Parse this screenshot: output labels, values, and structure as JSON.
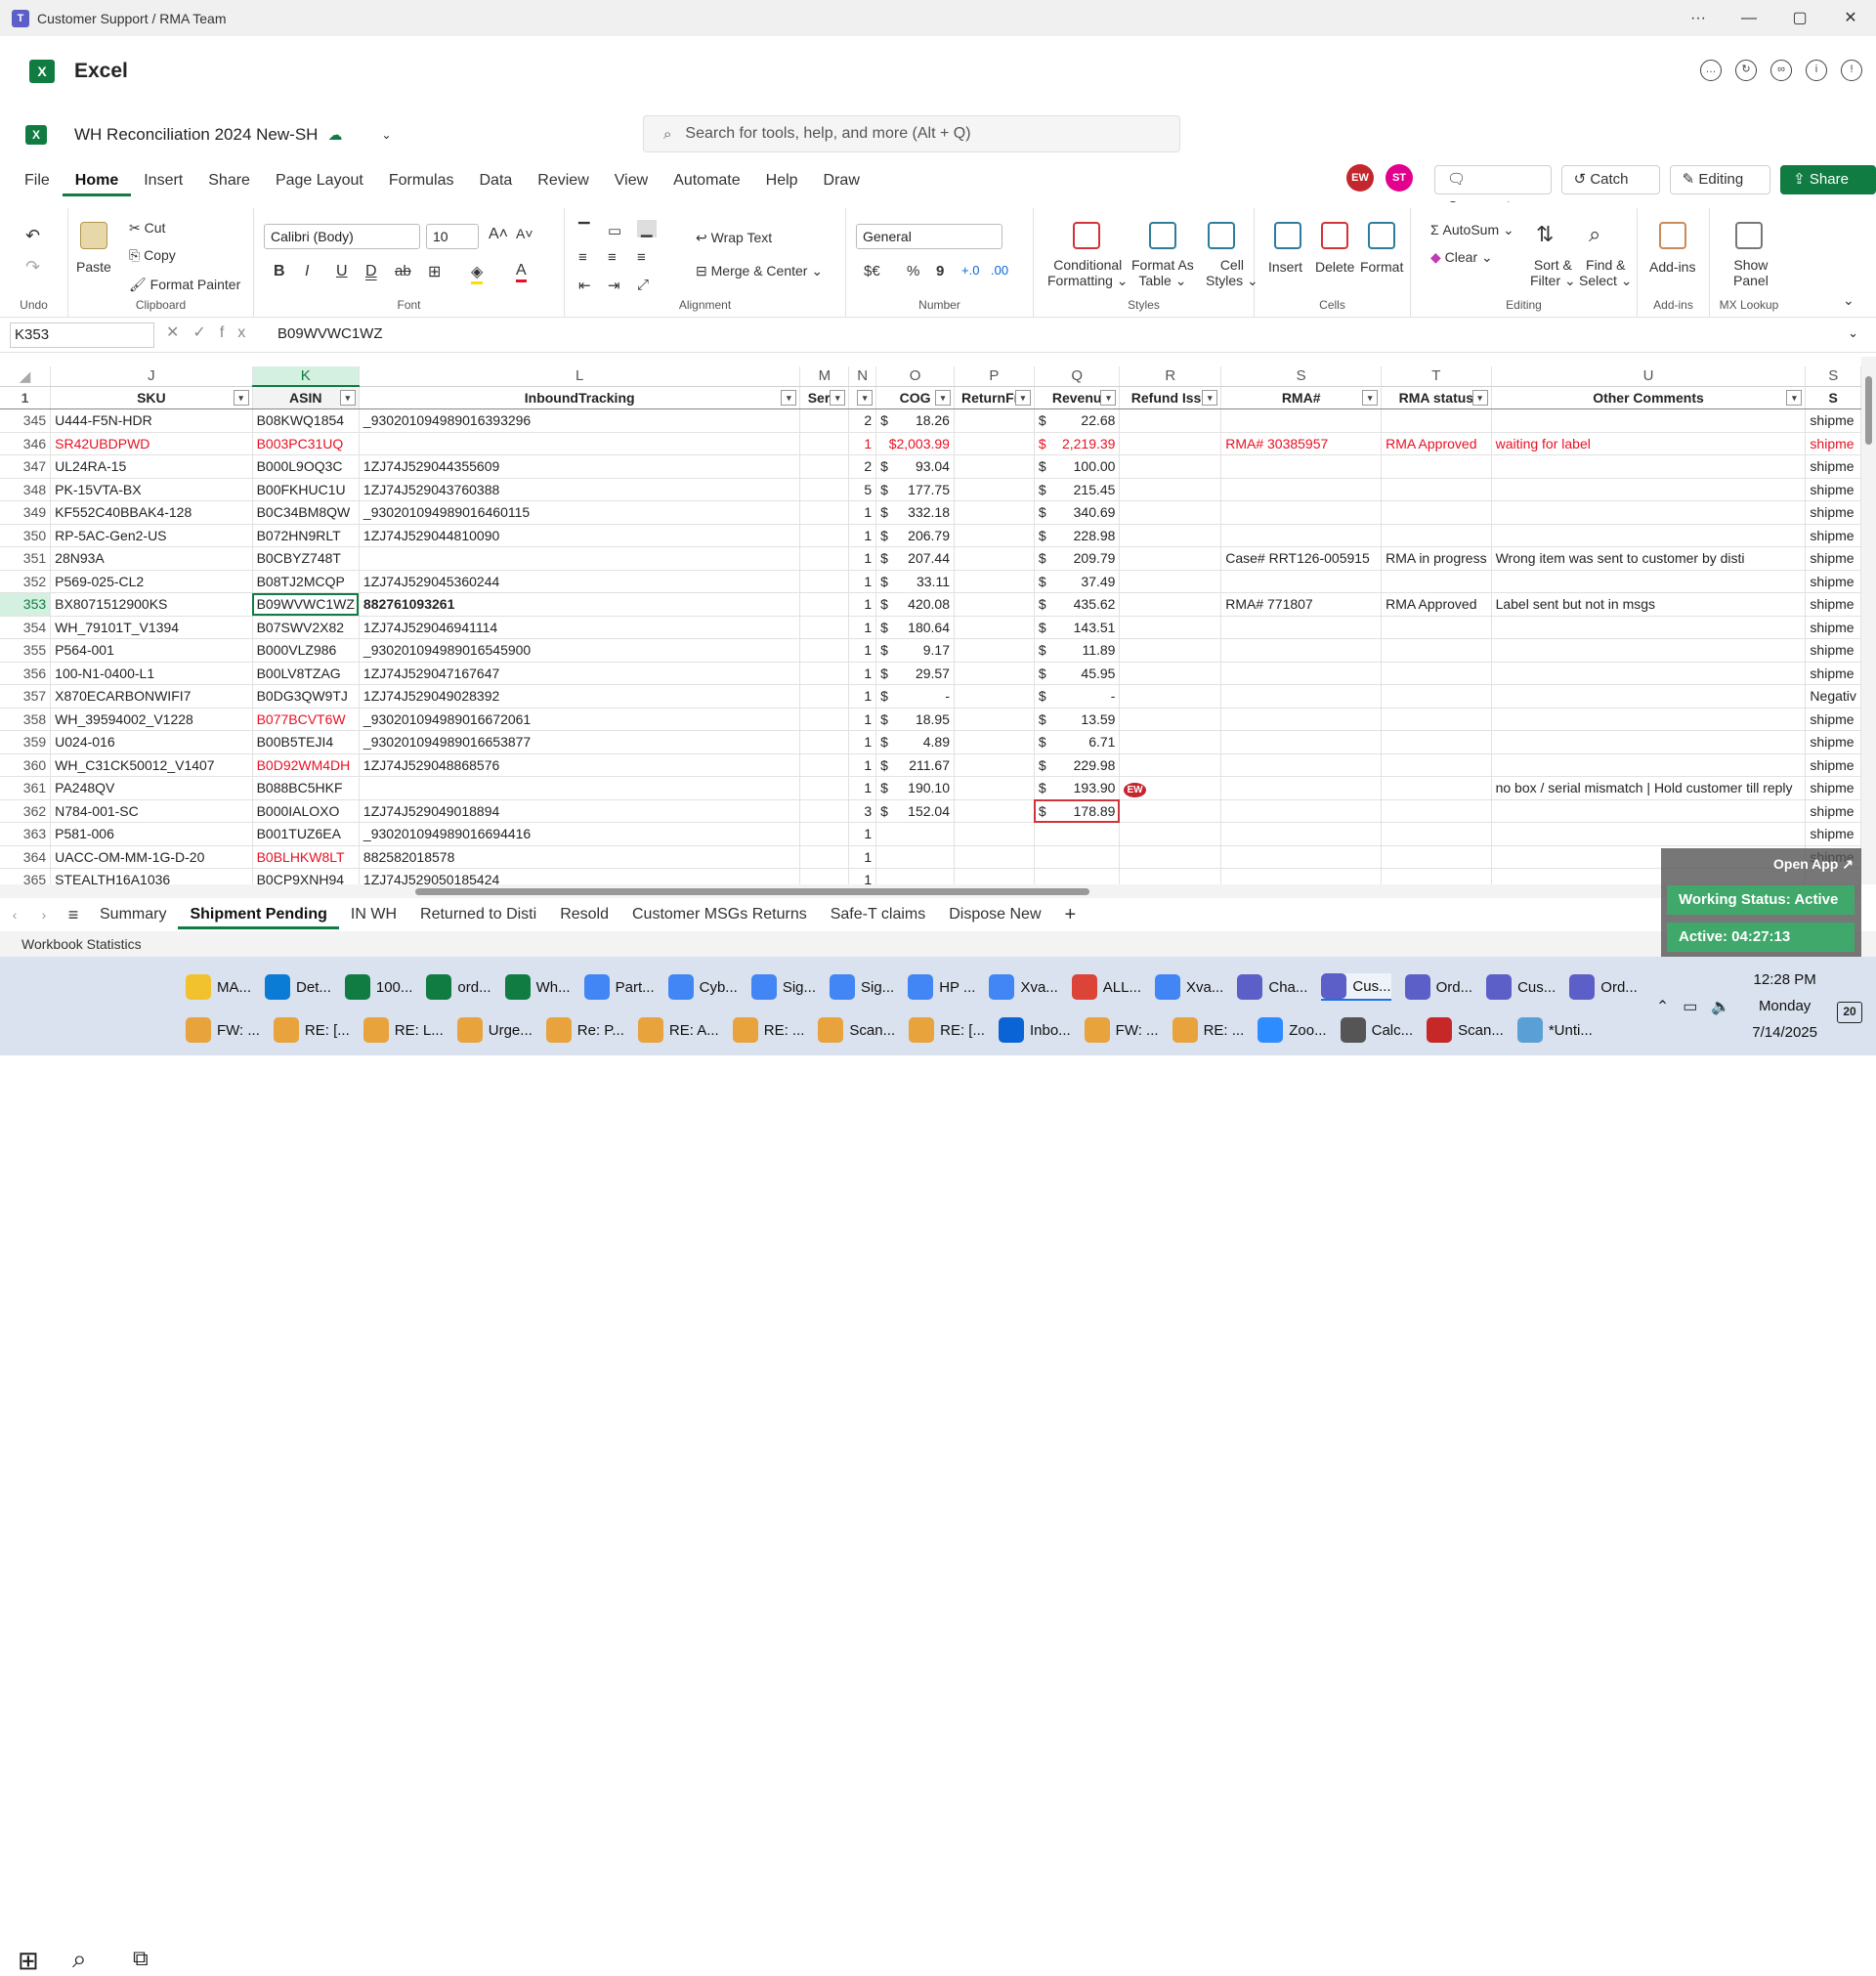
{
  "window": {
    "title": "Customer Support / RMA Team",
    "ctrl_more": "···",
    "ctrl_min": "—",
    "ctrl_max": "▢",
    "ctrl_close": "✕"
  },
  "app": {
    "name": "Excel",
    "logo": "X"
  },
  "document": {
    "name": "WH Reconciliation 2024 New-SH"
  },
  "search": {
    "placeholder": "Search for tools, help, and more (Alt + Q)"
  },
  "menu_tabs": [
    "File",
    "Home",
    "Insert",
    "Share",
    "Page Layout",
    "Formulas",
    "Data",
    "Review",
    "View",
    "Automate",
    "Help",
    "Draw"
  ],
  "active_tab": "Home",
  "avatars": [
    {
      "initials": "EW",
      "color": "#c4262e"
    },
    {
      "initials": "ST",
      "color": "#e3008c"
    }
  ],
  "top_buttons": {
    "comments": "Comments",
    "catchup": "Catch up",
    "editing": "Editing",
    "share": "Share"
  },
  "ribbon": {
    "undo_group": "Undo",
    "clipboard": {
      "label": "Clipboard",
      "paste": "Paste",
      "cut": "Cut",
      "copy": "Copy",
      "format_painter": "Format Painter"
    },
    "font": {
      "label": "Font",
      "family": "Calibri (Body)",
      "size": "10",
      "bold": "B",
      "italic": "I",
      "underline": "U",
      "dunder": "D",
      "strike": "ab"
    },
    "alignment": {
      "label": "Alignment",
      "wrap": "Wrap Text",
      "merge": "Merge & Center"
    },
    "number": {
      "label": "Number",
      "format": "General",
      "currency": "$€",
      "percent": "%",
      "comma": "9"
    },
    "styles": {
      "label": "Styles",
      "cond": "Conditional",
      "cond2": "Formatting",
      "fat": "Format As",
      "fat2": "Table",
      "cell": "Cell",
      "cell2": "Styles"
    },
    "cells": {
      "label": "Cells",
      "insert": "Insert",
      "delete": "Delete",
      "format": "Format"
    },
    "editing": {
      "label": "Editing",
      "autosum": "AutoSum",
      "clear": "Clear",
      "sort": "Sort &",
      "sort2": "Filter",
      "find": "Find &",
      "find2": "Select"
    },
    "addins": {
      "label": "Add-ins",
      "addins": "Add-ins"
    },
    "mxlookup": {
      "label": "MX Lookup",
      "show": "Show",
      "show2": "Panel"
    }
  },
  "formula_bar": {
    "name_box": "K353",
    "fx": "fx",
    "value": "B09WVWC1WZ"
  },
  "columns": [
    "J",
    "K",
    "L",
    "M",
    "N",
    "O",
    "P",
    "Q",
    "R",
    "S",
    "T",
    "U",
    "S"
  ],
  "header_row": {
    "num": "1",
    "cells": [
      "SKU",
      "ASIN",
      "InboundTracking",
      "Seria",
      "Q",
      "COG",
      "ReturnFre",
      "Revenu",
      "Refund Issu",
      "RMA#",
      "RMA status",
      "Other Comments",
      "S"
    ]
  },
  "rows": [
    {
      "n": "345",
      "sku": "U444-F5N-HDR",
      "asin": "B08KWQ1854",
      "track": "_930201094989016393296",
      "q": "2",
      "cog": "18.26",
      "rev": "22.68",
      "rma": "",
      "status": "",
      "comment": "",
      "s": "shipme",
      "red": false
    },
    {
      "n": "346",
      "sku": "SR42UBDPWD",
      "asin": "B003PC31UQ",
      "track": "",
      "q": "1",
      "cog": "$2,003.99",
      "rev": "2,219.39",
      "rma": "RMA# 30385957",
      "status": "RMA Approved",
      "comment": "waiting for label",
      "s": "shipme",
      "red": true
    },
    {
      "n": "347",
      "sku": "UL24RA-15",
      "asin": "B000L9OQ3C",
      "track": "1ZJ74J529044355609",
      "q": "2",
      "cog": "93.04",
      "rev": "100.00",
      "rma": "",
      "status": "",
      "comment": "",
      "s": "shipme",
      "red": false
    },
    {
      "n": "348",
      "sku": "PK-15VTA-BX",
      "asin": "B00FKHUC1U",
      "track": "1ZJ74J529043760388",
      "q": "5",
      "cog": "177.75",
      "rev": "215.45",
      "rma": "",
      "status": "",
      "comment": "",
      "s": "shipme",
      "red": false
    },
    {
      "n": "349",
      "sku": "KF552C40BBAK4-128",
      "asin": "B0C34BM8QW",
      "track": "_930201094989016460115",
      "q": "1",
      "cog": "332.18",
      "rev": "340.69",
      "rma": "",
      "status": "",
      "comment": "",
      "s": "shipme",
      "red": false
    },
    {
      "n": "350",
      "sku": "RP-5AC-Gen2-US",
      "asin": "B072HN9RLT",
      "track": "1ZJ74J529044810090",
      "q": "1",
      "cog": "206.79",
      "rev": "228.98",
      "rma": "",
      "status": "",
      "comment": "",
      "s": "shipme",
      "red": false
    },
    {
      "n": "351",
      "sku": "28N93A",
      "asin": "B0CBYZ748T",
      "track": "",
      "q": "1",
      "cog": "207.44",
      "rev": "209.79",
      "rma": "Case# RRT126-005915",
      "status": "RMA in progress",
      "comment": "Wrong item was sent to customer by disti",
      "s": "shipme",
      "red": false
    },
    {
      "n": "352",
      "sku": "P569-025-CL2",
      "asin": "B08TJ2MCQP",
      "track": "1ZJ74J529045360244",
      "q": "1",
      "cog": "33.11",
      "rev": "37.49",
      "rma": "",
      "status": "",
      "comment": "",
      "s": "shipme",
      "red": false
    },
    {
      "n": "353",
      "sku": "BX8071512900KS",
      "asin": "B09WVWC1WZ",
      "track": "882761093261",
      "q": "1",
      "cog": "420.08",
      "rev": "435.62",
      "rma": "RMA# 771807",
      "status": "RMA Approved",
      "comment": "Label sent but not in msgs",
      "s": "shipme",
      "red": false
    },
    {
      "n": "354",
      "sku": "WH_79101T_V1394",
      "asin": "B07SWV2X82",
      "track": "1ZJ74J529046941114",
      "q": "1",
      "cog": "180.64",
      "rev": "143.51",
      "rma": "",
      "status": "",
      "comment": "",
      "s": "shipme",
      "red": false
    },
    {
      "n": "355",
      "sku": "P564-001",
      "asin": "B000VLZ986",
      "track": "_930201094989016545900",
      "q": "1",
      "cog": "9.17",
      "rev": "11.89",
      "rma": "",
      "status": "",
      "comment": "",
      "s": "shipme",
      "red": false
    },
    {
      "n": "356",
      "sku": "100-N1-0400-L1",
      "asin": "B00LV8TZAG",
      "track": "1ZJ74J529047167647",
      "q": "1",
      "cog": "29.57",
      "rev": "45.95",
      "rma": "",
      "status": "",
      "comment": "",
      "s": "shipme",
      "red": false
    },
    {
      "n": "357",
      "sku": "X870ECARBONWIFI7",
      "asin": "B0DG3QW9TJ",
      "track": "1ZJ74J529049028392",
      "q": "1",
      "cog": "-",
      "rev": "-",
      "rma": "",
      "status": "",
      "comment": "",
      "s": "Negativ",
      "red": false
    },
    {
      "n": "358",
      "sku": "WH_39594002_V1228",
      "asin": "B077BCVT6W",
      "track": "_930201094989016672061",
      "q": "1",
      "cog": "18.95",
      "rev": "13.59",
      "rma": "",
      "status": "",
      "comment": "",
      "s": "shipme",
      "red": false
    },
    {
      "n": "359",
      "sku": "U024-016",
      "asin": "B00B5TEJI4",
      "track": "_930201094989016653877",
      "q": "1",
      "cog": "4.89",
      "rev": "6.71",
      "rma": "",
      "status": "",
      "comment": "",
      "s": "shipme",
      "red": false
    },
    {
      "n": "360",
      "sku": "WH_C31CK50012_V1407",
      "asin": "B0D92WM4DH",
      "track": "1ZJ74J529048868576",
      "q": "1",
      "cog": "211.67",
      "rev": "229.98",
      "rma": "",
      "status": "",
      "comment": "",
      "s": "shipme",
      "red": false
    },
    {
      "n": "361",
      "sku": "PA248QV",
      "asin": "B088BC5HKF",
      "track": "",
      "q": "1",
      "cog": "190.10",
      "rev": "193.90",
      "rma": "",
      "status": "",
      "comment": "no box / serial mismatch  | Hold customer till reply",
      "s": "shipme",
      "red": false
    },
    {
      "n": "362",
      "sku": "N784-001-SC",
      "asin": "B000IALOXO",
      "track": "1ZJ74J529049018894",
      "q": "3",
      "cog": "152.04",
      "rev": "178.89",
      "rma": "",
      "status": "",
      "comment": "",
      "s": "shipme",
      "red": false
    },
    {
      "n": "363",
      "sku": "P581-006",
      "asin": "B001TUZ6EA",
      "track": "_930201094989016694416",
      "q": "1",
      "cog": "",
      "rev": "",
      "rma": "",
      "status": "",
      "comment": "",
      "s": "shipme",
      "red": false
    },
    {
      "n": "364",
      "sku": "UACC-OM-MM-1G-D-20",
      "asin": "B0BLHKW8LT",
      "track": "882582018578",
      "q": "1",
      "cog": "",
      "rev": "",
      "rma": "",
      "status": "",
      "comment": "",
      "s": "shipme",
      "red": false
    },
    {
      "n": "365",
      "sku": "STEALTH16A1036",
      "asin": "B0CP9XNH94",
      "track": "1ZJ74J529050185424",
      "q": "1",
      "cog": "",
      "rev": "",
      "rma": "",
      "status": "",
      "comment": "",
      "s": "",
      "red": false
    }
  ],
  "red_asins": [
    "B003PC31UQ",
    "B077BCVT6W",
    "B0D92WM4DH",
    "B0BLHKW8LT"
  ],
  "comment_marker": "EW",
  "sheets": [
    "Summary",
    "Shipment Pending",
    "IN WH",
    "Returned to Disti",
    "Resold",
    "Customer MSGs Returns",
    "Safe-T claims",
    "Dispose New"
  ],
  "active_sheet": "Shipment Pending",
  "status": {
    "left": "Workbook Statistics"
  },
  "overlay": {
    "open_app": "Open App",
    "working": "Working Status: Active",
    "active": "Active: 04:27:13"
  },
  "taskbar_row1": [
    {
      "label": "MA...",
      "color": "#f2c12e"
    },
    {
      "label": "Det...",
      "color": "#0a7cd6"
    },
    {
      "label": "100...",
      "color": "#107c41"
    },
    {
      "label": "ord...",
      "color": "#107c41"
    },
    {
      "label": "Wh...",
      "color": "#107c41"
    },
    {
      "label": "Part...",
      "color": "#4285f4"
    },
    {
      "label": "Cyb...",
      "color": "#4285f4"
    },
    {
      "label": "Sig...",
      "color": "#4285f4"
    },
    {
      "label": "Sig...",
      "color": "#4285f4"
    },
    {
      "label": "HP ...",
      "color": "#4285f4"
    },
    {
      "label": "Xva...",
      "color": "#4285f4"
    },
    {
      "label": "ALL...",
      "color": "#db4437"
    },
    {
      "label": "Xva...",
      "color": "#4285f4"
    },
    {
      "label": "Cha...",
      "color": "#5b5fc7"
    },
    {
      "label": "Cus...",
      "color": "#5b5fc7"
    },
    {
      "label": "Ord...",
      "color": "#5b5fc7"
    },
    {
      "label": "Cus...",
      "color": "#5b5fc7"
    },
    {
      "label": "Ord...",
      "color": "#5b5fc7"
    }
  ],
  "taskbar_row2": [
    {
      "label": "FW: ...",
      "color": "#e8a33d"
    },
    {
      "label": "RE: [...",
      "color": "#e8a33d"
    },
    {
      "label": "RE: L...",
      "color": "#e8a33d"
    },
    {
      "label": "Urge...",
      "color": "#e8a33d"
    },
    {
      "label": "Re: P...",
      "color": "#e8a33d"
    },
    {
      "label": "RE: A...",
      "color": "#e8a33d"
    },
    {
      "label": "RE: ...",
      "color": "#e8a33d"
    },
    {
      "label": "Scan...",
      "color": "#e8a33d"
    },
    {
      "label": "RE: [...",
      "color": "#e8a33d"
    },
    {
      "label": "Inbo...",
      "color": "#0a64d6"
    },
    {
      "label": "FW: ...",
      "color": "#e8a33d"
    },
    {
      "label": "RE: ...",
      "color": "#e8a33d"
    },
    {
      "label": "Zoo...",
      "color": "#2d8cff"
    },
    {
      "label": "Calc...",
      "color": "#555"
    },
    {
      "label": "Scan...",
      "color": "#c62828"
    },
    {
      "label": "*Unti...",
      "color": "#5aa0d6"
    }
  ],
  "clock": {
    "time": "12:28 PM",
    "day": "Monday",
    "date": "7/14/2025"
  },
  "notifications": "20"
}
